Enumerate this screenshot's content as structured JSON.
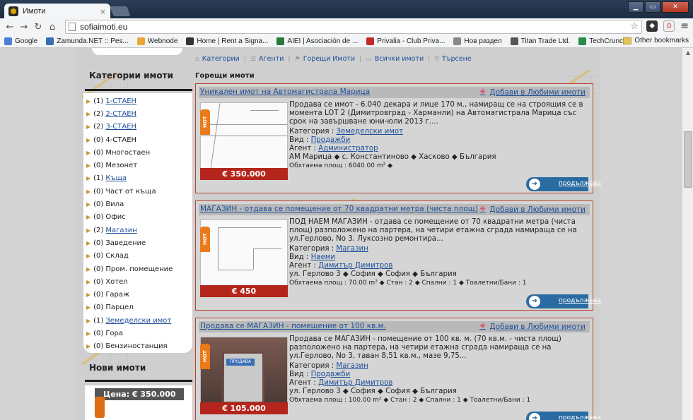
{
  "browser": {
    "tab_title": "Имоти",
    "tab_close": "×",
    "url": "sofiaimoti.eu",
    "bookmarks": [
      {
        "label": "Google"
      },
      {
        "label": "Zamunda.NET :: Pes..."
      },
      {
        "label": "Webnode"
      },
      {
        "label": "Home | Rent a Signa..."
      },
      {
        "label": "AIEI | Asociación de ..."
      },
      {
        "label": "Privalia - Club Priva..."
      },
      {
        "label": "Нов раздел"
      },
      {
        "label": "Titan Trade Ltd."
      },
      {
        "label": "TechCrunch"
      }
    ],
    "other_bookmarks": "Other bookmarks"
  },
  "topnav": {
    "items": [
      "Категории",
      "Агенти",
      "Горещи Имоти",
      "Всички имоти",
      "Търсене"
    ]
  },
  "sidebar": {
    "title": "Категории имоти",
    "items": [
      {
        "count": "(1)",
        "label": "1-СТАЕН",
        "link": true
      },
      {
        "count": "(2)",
        "label": "2-СТАЕН",
        "link": true
      },
      {
        "count": "(2)",
        "label": "3-СТАЕН",
        "link": true
      },
      {
        "count": "(0)",
        "label": "4-СТАЕН",
        "link": false
      },
      {
        "count": "(0)",
        "label": "Многостаен",
        "link": false
      },
      {
        "count": "(0)",
        "label": "Мезонет",
        "link": false
      },
      {
        "count": "(1)",
        "label": "Къща",
        "link": true
      },
      {
        "count": "(0)",
        "label": "Част от къща",
        "link": false
      },
      {
        "count": "(0)",
        "label": "Вила",
        "link": false
      },
      {
        "count": "(0)",
        "label": "Офис",
        "link": false
      },
      {
        "count": "(2)",
        "label": "Магазин",
        "link": true
      },
      {
        "count": "(0)",
        "label": "Заведение",
        "link": false
      },
      {
        "count": "(0)",
        "label": "Склад",
        "link": false
      },
      {
        "count": "(0)",
        "label": "Пром. помещение",
        "link": false
      },
      {
        "count": "(0)",
        "label": "Хотел",
        "link": false
      },
      {
        "count": "(0)",
        "label": "Гараж",
        "link": false
      },
      {
        "count": "(0)",
        "label": "Парцел",
        "link": false
      },
      {
        "count": "(1)",
        "label": "Земеделски имот",
        "link": true
      },
      {
        "count": "(0)",
        "label": "Гора",
        "link": false
      },
      {
        "count": "(0)",
        "label": "Бензиностанция",
        "link": false
      }
    ],
    "new_title": "Нови имоти",
    "new_price": "Цена:  € 350.000"
  },
  "main": {
    "heading": "Горещи имоти",
    "fav_label": "Добави в Любими имоти",
    "more_label": "продължава",
    "hot_label": "HOT",
    "listings": [
      {
        "title": "Уникален имот на Автомагистрала Марица",
        "price": "€ 350.000",
        "desc": "Продава се имот - 6.040 декара и лице 170 м., намиращ се на строящия се в момента LOT 2 (Димитровград - Харманли) на Автомагистрала Марица със срок на завършване юни-юли 2013 г....",
        "category_label": "Категория :",
        "category": "Земеделски имот",
        "type_label": "Вид :",
        "type": "Продажби",
        "agent_label": "Агент :",
        "agent": "Администратор",
        "location": "АМ Марица  ◆ с. Константиново ◆ Хасково ◆ България",
        "area": "Обхтаема площ : 6040.00 m² ◆"
      },
      {
        "title": "МАГАЗИН - отдава се помещение от 70 квадратни метра (чиста площ)",
        "price": "€ 450",
        "desc": "  ПОД НАЕМ МАГАЗИН - отдава се помещение от 70 квадратни метра (чиста площ) разположено на партера, на четири етажна сграда намираща се на ул.Герлово, No 3. Луксозно ремонтира...",
        "category_label": "Категория :",
        "category": "Магазин",
        "type_label": "Вид :",
        "type": "Наеми",
        "agent_label": "Агент :",
        "agent": "Димитър Димитров",
        "location": "ул. Герлово 3 ◆ София ◆ София ◆ България",
        "area": "Обхтаема площ : 70.00 m² ◆  Стан : 2 ◆  Спални : 1 ◆  Тоалетни/Бани : 1"
      },
      {
        "title": "Продава се МАГАЗИН - помещение от 100 кв.м.",
        "price": "€ 105.000",
        "desc": "Продава се МАГАЗИН - помещение от 100 кв. м. (70 кв.м. - чиста площ) разположено на партера, на четири етажна сграда намираща се на ул.Герлово, No 3, таван 8,51 кв.м., мазе 9,75...",
        "category_label": "Категория :",
        "category": "Магазин",
        "type_label": "Вид :",
        "type": "Продажби",
        "agent_label": "Агент :",
        "agent": "Димитър Димитров",
        "location": "ул. Герлово 3 ◆ София ◆ София ◆ България",
        "area": "Обхтаема площ : 100.00 m² ◆  Стан : 2 ◆  Спални : 1 ◆  Тоалетни/Бани : 1",
        "sign": "ПРОДАВА"
      }
    ]
  }
}
